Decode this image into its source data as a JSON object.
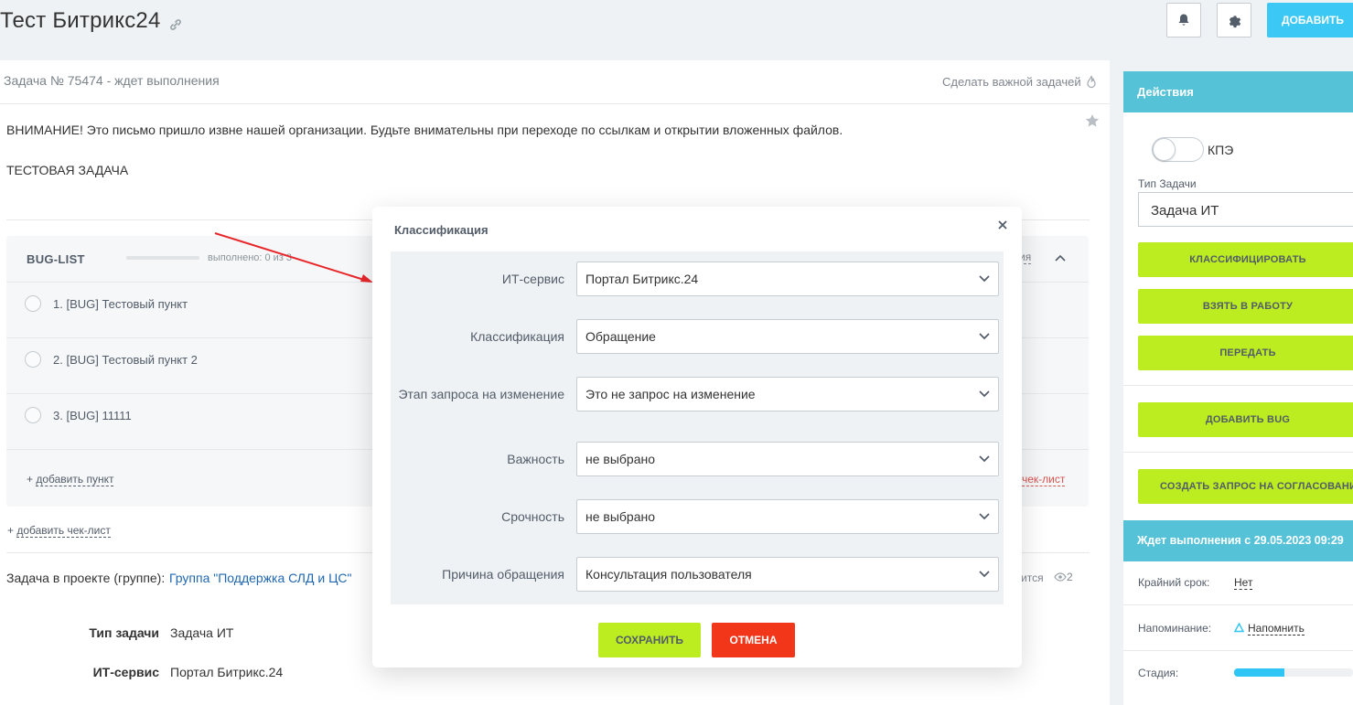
{
  "header": {
    "title": "Тест Битрикс24",
    "add_label": "ДОБАВИТЬ"
  },
  "task": {
    "number_status": "Задача № 75474 - ждет выполнения",
    "make_important": "Сделать важной задачей",
    "warning": "ВНИМАНИЕ! Это письмо пришло извне нашей организации. Будьте внимательны при переходе по ссылкам и открытии вложенных файлов.",
    "description": "ТЕСТОВАЯ ЗАДАЧА",
    "checklist": {
      "title": "BUG-LIST",
      "progress": 0,
      "done_text": "выполнено: 0 из 3",
      "header_link_fragment": "ия",
      "items": [
        {
          "label": "1. [BUG] Тестовый пункт"
        },
        {
          "label": "2. [BUG] Тестовый пункт 2"
        },
        {
          "label": "3. [BUG] 11111"
        }
      ],
      "add_item_prefix": "+",
      "add_item": "добавить пункт",
      "right_link_fragment": "чек-лист"
    },
    "add_checklist_prefix": "+",
    "add_checklist": "добавить чек-лист",
    "project_label": "Задача в проекте (группе):",
    "project_name": "Группа \"Поддержка СЛД и ЦС\"",
    "project_right_fragment": "ится",
    "views_count": "2",
    "props": [
      {
        "label": "Тип задачи",
        "value": "Задача ИТ"
      },
      {
        "label": "ИТ-сервис",
        "value": "Портал Битрикс.24"
      }
    ]
  },
  "actions_panel": {
    "title": "Действия",
    "kpe_label": "КПЭ",
    "kpe_on": false,
    "task_type_label": "Тип Задачи",
    "task_type_value": "Задача ИТ",
    "buttons": {
      "classify": "КЛАССИФИЦИРОВАТЬ",
      "take": "ВЗЯТЬ В РАБОТУ",
      "transfer": "ПЕРЕДАТЬ",
      "add_bug": "ДОБАВИТЬ BUG",
      "create_request": "СОЗДАТЬ ЗАПРОС НА СОГЛАСОВАНИЕ"
    }
  },
  "status_panel": {
    "title": "Ждет выполнения с 29.05.2023 09:29",
    "deadline_label": "Крайний срок:",
    "deadline_value": "Нет",
    "reminder_label": "Напоминание:",
    "reminder_value": "Напомнить",
    "stage_label": "Стадия:",
    "stage_progress": 0.42
  },
  "modal": {
    "title": "Классификация",
    "fields": [
      {
        "label": "ИТ-сервис",
        "value": "Портал Битрикс.24"
      },
      {
        "label": "Классификация",
        "value": "Обращение"
      },
      {
        "label": "Этап запроса на изменение",
        "value": "Это не запрос на изменение"
      },
      {
        "label": "Важность",
        "value": "не выбрано"
      },
      {
        "label": "Срочность",
        "value": "не выбрано"
      },
      {
        "label": "Причина обращения",
        "value": "Консультация пользователя"
      }
    ],
    "save_label": "СОХРАНИТЬ",
    "cancel_label": "ОТМЕНА"
  },
  "colors": {
    "accent_blue": "#3bc8f5",
    "panel_header": "#55c2d8",
    "green_button": "#bbed21",
    "cancel_red": "#f1361a",
    "link_blue": "#2067b0",
    "annotation_arrow": "#e8262a"
  },
  "icons": [
    "link-icon",
    "bell-icon",
    "gear-icon",
    "flame-icon",
    "star-icon",
    "chevron-up-icon",
    "eye-icon",
    "close-icon",
    "chevron-down-icon",
    "bell-triangle-icon",
    "annotation-arrow"
  ]
}
